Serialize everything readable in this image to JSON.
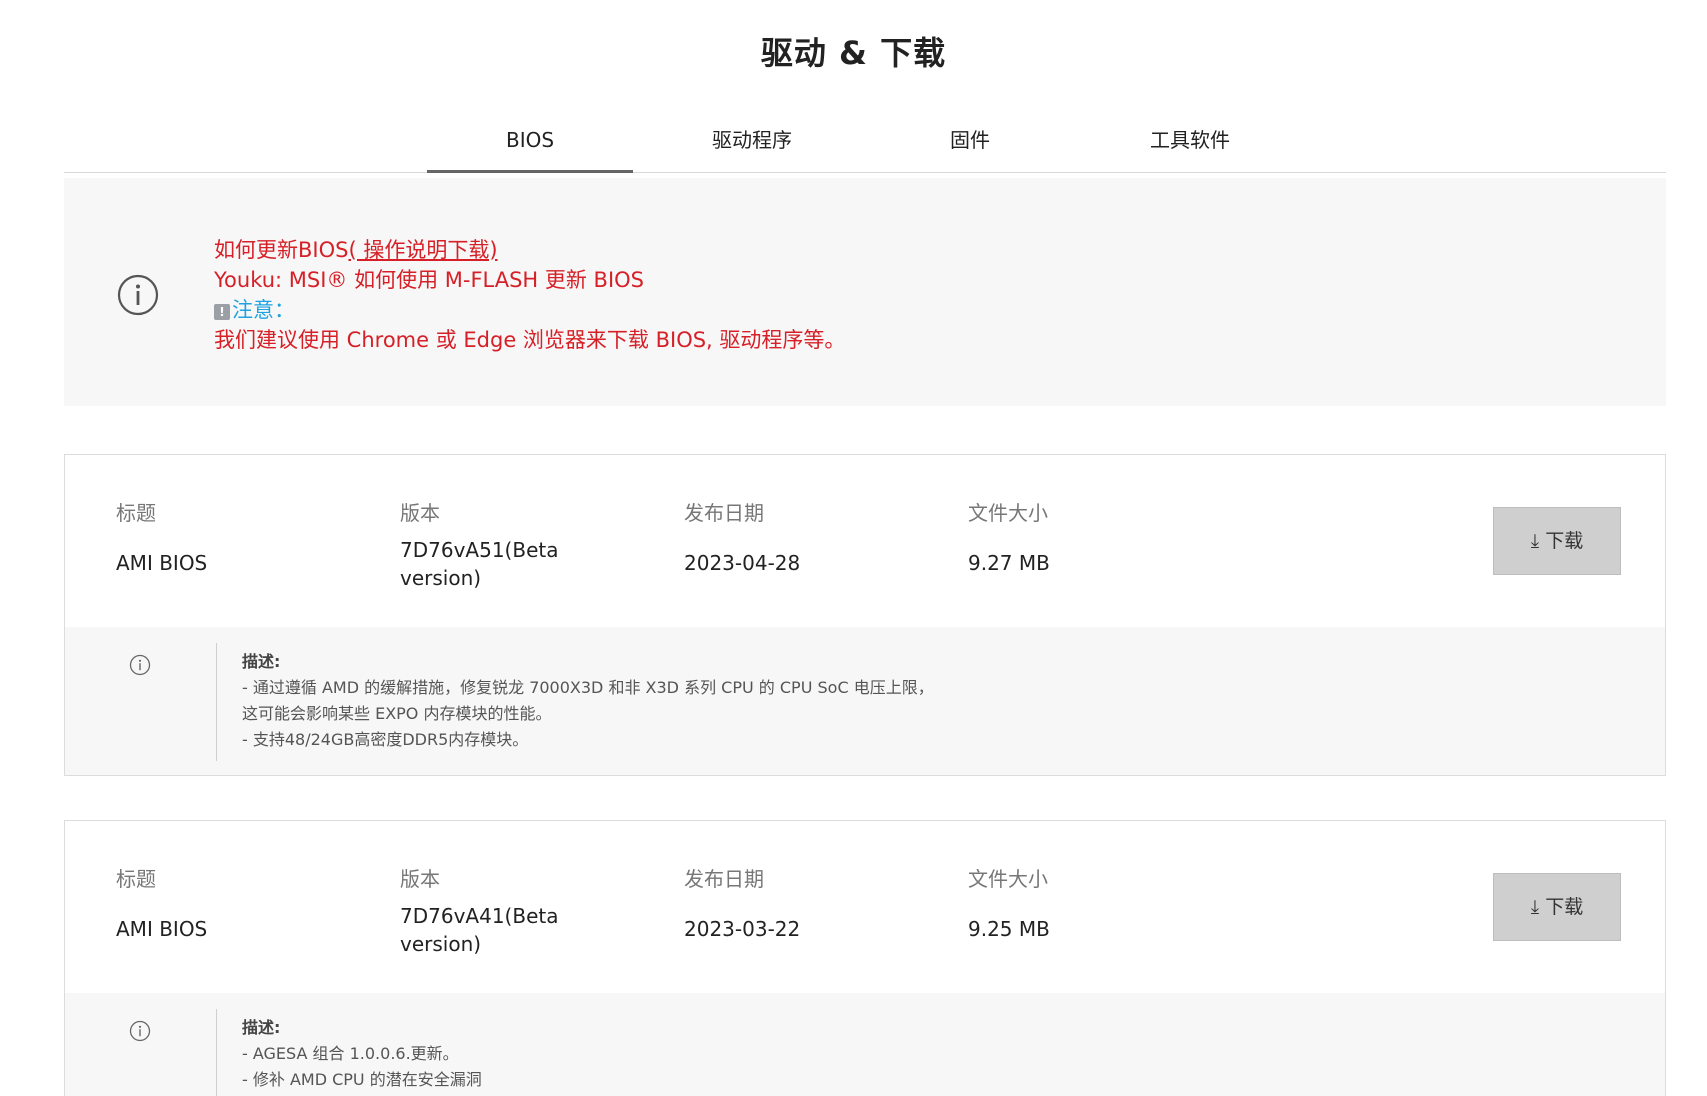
{
  "page": {
    "title": "驱动 & 下载"
  },
  "tabs": [
    {
      "label": "BIOS",
      "active": true
    },
    {
      "label": "驱动程序",
      "active": false
    },
    {
      "label": "固件",
      "active": false
    },
    {
      "label": "工具软件",
      "active": false
    }
  ],
  "notice": {
    "line1_prefix": "如何更新BIOS",
    "line1_link": "( 操作说明下载)",
    "line2": "Youku: MSI® 如何使用 M-FLASH 更新 BIOS",
    "note_label": "注意：",
    "line4": "我们建议使用 Chrome 或 Edge 浏览器来下载 BIOS, 驱动程序等。"
  },
  "labels": {
    "title": "标题",
    "version": "版本",
    "date": "发布日期",
    "size": "文件大小",
    "download": "⤓ 下载",
    "desc_title": "描述:"
  },
  "items": [
    {
      "title": "AMI BIOS",
      "version": "7D76vA51(Beta version)",
      "date": "2023-04-28",
      "size": "9.27 MB",
      "desc": [
        "- 通过遵循 AMD 的缓解措施，修复锐龙 7000X3D 和非 X3D 系列 CPU 的 CPU SoC 电压上限，",
        "这可能会影响某些 EXPO 内存模块的性能。",
        "- 支持48/24GB高密度DDR5内存模块。"
      ]
    },
    {
      "title": "AMI BIOS",
      "version": "7D76vA41(Beta version)",
      "date": "2023-03-22",
      "size": "9.25 MB",
      "desc": [
        "- AGESA 组合 1.0.0.6.更新。",
        "- 修补 AMD CPU 的潜在安全漏洞"
      ]
    }
  ],
  "colors": {
    "accent_red": "#d61f26",
    "note_blue": "#1fa3e0",
    "button_gray": "#cfcfcf"
  }
}
